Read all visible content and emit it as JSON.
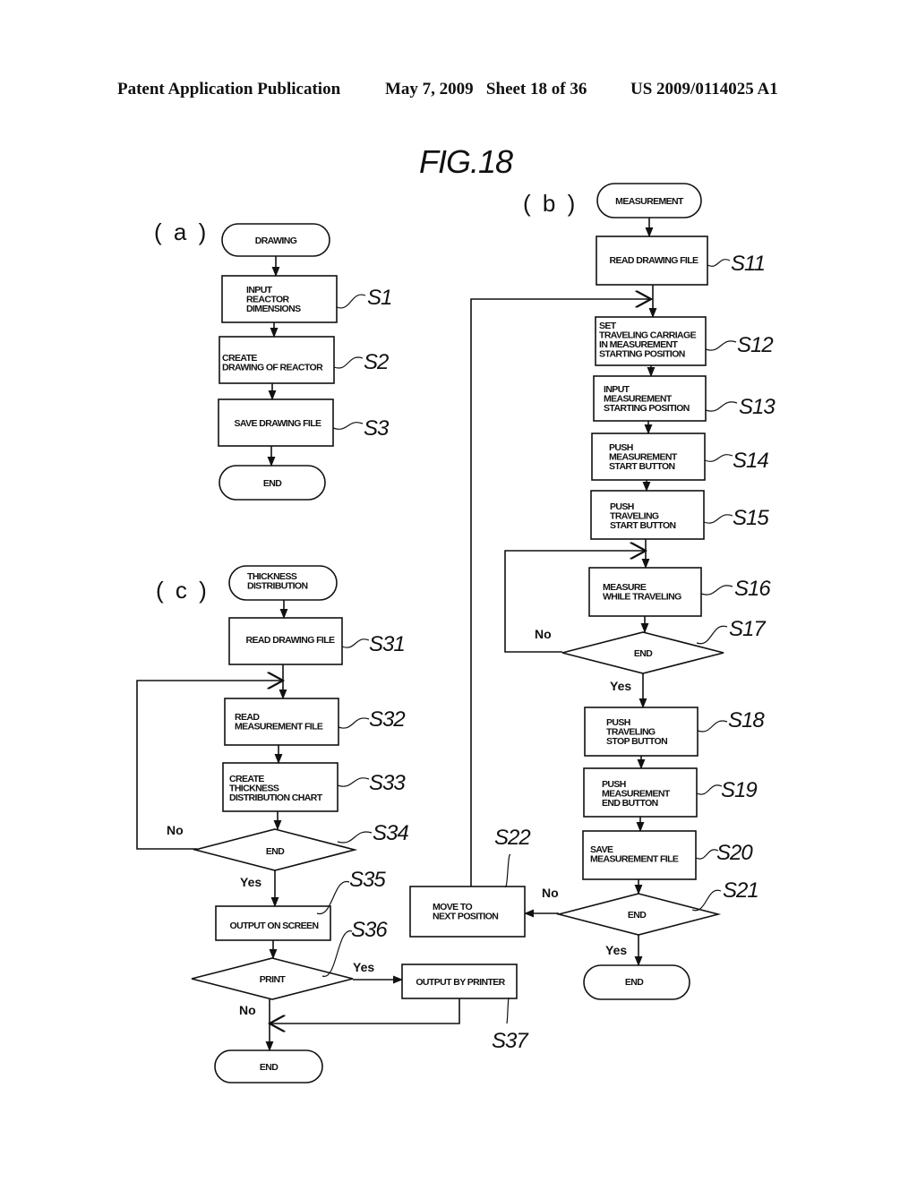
{
  "header": {
    "publication": "Patent Application Publication",
    "date_sheet": "May 7, 2009   Sheet 18 of 36",
    "patent_number": "US 2009/0114025 A1"
  },
  "figure_title": "FIG.18",
  "panels": {
    "a": {
      "label": "( a )",
      "start": [
        "DRAWING"
      ],
      "steps": [
        {
          "id": "S1",
          "lines": [
            "INPUT",
            "REACTOR",
            "DIMENSIONS"
          ]
        },
        {
          "id": "S2",
          "lines": [
            "CREATE",
            "DRAWING OF REACTOR"
          ]
        },
        {
          "id": "S3",
          "lines": [
            "SAVE DRAWING FILE"
          ]
        }
      ],
      "end": [
        "END"
      ]
    },
    "b": {
      "label": "( b )",
      "start": [
        "MEASUREMENT"
      ],
      "steps": [
        {
          "id": "S11",
          "lines": [
            "READ DRAWING FILE"
          ]
        },
        {
          "id": "S12",
          "lines": [
            "SET",
            "TRAVELING CARRIAGE",
            "IN MEASUREMENT",
            "STARTING POSITION"
          ]
        },
        {
          "id": "S13",
          "lines": [
            "INPUT",
            "MEASUREMENT",
            "STARTING POSITION"
          ]
        },
        {
          "id": "S14",
          "lines": [
            "PUSH",
            "MEASUREMENT",
            "START BUTTON"
          ]
        },
        {
          "id": "S15",
          "lines": [
            "PUSH",
            "TRAVELING",
            "START BUTTON"
          ]
        },
        {
          "id": "S16",
          "lines": [
            "MEASURE",
            "WHILE TRAVELING"
          ]
        },
        {
          "id": "S17",
          "lines": [
            "END"
          ],
          "type": "decision",
          "yes": "Yes",
          "no": "No"
        },
        {
          "id": "S18",
          "lines": [
            "PUSH",
            "TRAVELING",
            "STOP BUTTON"
          ]
        },
        {
          "id": "S19",
          "lines": [
            "PUSH",
            "MEASUREMENT",
            "END BUTTON"
          ]
        },
        {
          "id": "S20",
          "lines": [
            "SAVE",
            "MEASUREMENT FILE"
          ]
        },
        {
          "id": "S21",
          "lines": [
            "END"
          ],
          "type": "decision",
          "yes": "Yes",
          "no": "No"
        },
        {
          "id": "S22",
          "lines": [
            "MOVE TO",
            "NEXT POSITION"
          ]
        }
      ],
      "end": [
        "END"
      ]
    },
    "c": {
      "label": "( c )",
      "start": [
        "THICKNESS",
        "DISTRIBUTION"
      ],
      "steps": [
        {
          "id": "S31",
          "lines": [
            "READ DRAWING FILE"
          ]
        },
        {
          "id": "S32",
          "lines": [
            "READ",
            "MEASUREMENT FILE"
          ]
        },
        {
          "id": "S33",
          "lines": [
            "CREATE",
            "THICKNESS",
            "DISTRIBUTION CHART"
          ]
        },
        {
          "id": "S34",
          "lines": [
            "END"
          ],
          "type": "decision",
          "yes": "Yes",
          "no": "No"
        },
        {
          "id": "S35",
          "lines": [
            "OUTPUT ON SCREEN"
          ]
        },
        {
          "id": "S36",
          "lines": [
            "PRINT"
          ],
          "type": "decision",
          "yes": "Yes",
          "no": "No"
        },
        {
          "id": "S37",
          "lines": [
            "OUTPUT BY PRINTER"
          ]
        }
      ],
      "end": [
        "END"
      ]
    }
  }
}
